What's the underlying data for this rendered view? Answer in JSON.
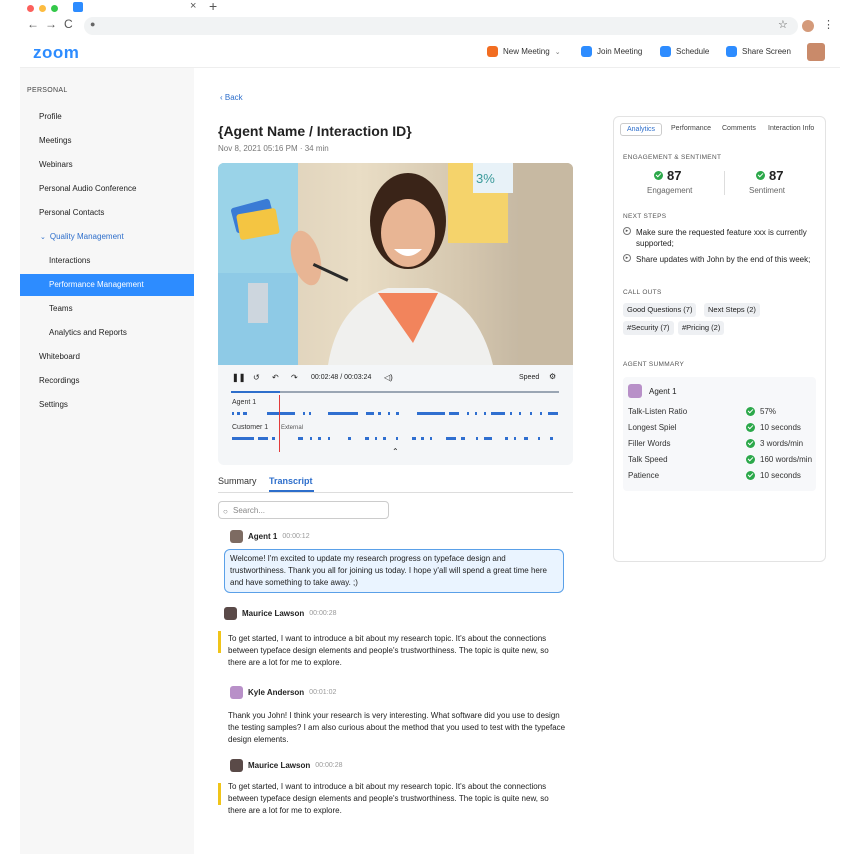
{
  "browser": {
    "back_arrow": "←",
    "forward_arrow": "→",
    "reload": "C",
    "tab_close": "×",
    "tab_new": "+"
  },
  "app": {
    "logo": "zoom",
    "toolbar": {
      "new_meeting": "New Meeting",
      "join_meeting": "Join Meeting",
      "schedule": "Schedule",
      "share_screen": "Share Screen"
    }
  },
  "sidebar": {
    "section": "PERSONAL",
    "items": [
      {
        "label": "Profile"
      },
      {
        "label": "Meetings"
      },
      {
        "label": "Webinars"
      },
      {
        "label": "Personal Audio Conference"
      },
      {
        "label": "Personal Contacts"
      },
      {
        "label": "Quality Management"
      },
      {
        "label": "Interactions"
      },
      {
        "label": "Performance Management"
      },
      {
        "label": "Teams"
      },
      {
        "label": "Analytics and Reports"
      },
      {
        "label": "Whiteboard"
      },
      {
        "label": "Recordings"
      },
      {
        "label": "Settings"
      }
    ]
  },
  "main": {
    "back": "Back",
    "title": "{Agent Name / Interaction ID}",
    "subtitle": "Nov 8, 2021 05:16 PM · 34 min",
    "player": {
      "time": "00:02:48 / 00:03:24",
      "speed": "Speed",
      "track_agent": "Agent 1",
      "track_customer": "Customer 1",
      "external": "External",
      "progress": 0.15
    },
    "tabs": {
      "summary": "Summary",
      "transcript": "Transcript"
    },
    "search_placeholder": "Search...",
    "transcript": [
      {
        "name": "Agent 1",
        "time": "00:00:12",
        "text": "Welcome! I'm excited to update my research progress on typeface design and trustworthiness. Thank you all for joining us today. I hope y'all will spend a great time here and have something to take away. ;)"
      },
      {
        "name": "Maurice Lawson",
        "time": "00:00:28",
        "text": "To get started, I want to introduce a bit about my research topic. It's about the connections between typeface design elements and people's trustworthiness. The topic is quite new, so there are a lot for me to explore."
      },
      {
        "name": "Kyle Anderson",
        "time": "00:01:02",
        "text": "Thank you John! I think your research is very interesting. What software did you use to design the testing samples? I am also curious about the method that you used to test with the typeface design elements."
      },
      {
        "name": "Maurice Lawson",
        "time": "00:00:28",
        "text": "To get started, I want to introduce a bit about my research topic. It's about the connections between typeface design elements and people's trustworthiness. The topic is quite new, so there are a lot for me to explore."
      }
    ]
  },
  "right_panel": {
    "tabs": [
      "Analytics",
      "Performance",
      "Comments",
      "Interaction Info"
    ],
    "engagement_title": "ENGAGEMENT & SENTIMENT",
    "engagement": {
      "value": "87",
      "label": "Engagement"
    },
    "sentiment": {
      "value": "87",
      "label": "Sentiment"
    },
    "next_steps_title": "NEXT STEPS",
    "next_steps": [
      "Make sure the requested feature xxx is currently supported;",
      "Share updates with John by the end of this week;"
    ],
    "callouts_title": "CALL OUTS",
    "callouts": [
      "Good Questions (7)",
      "Next Steps (2)",
      "#Security (7)",
      "#Pricing (2)"
    ],
    "agent_summary_title": "AGENT SUMMARY",
    "agent_name": "Agent 1",
    "metrics": [
      {
        "label": "Talk-Listen Ratio",
        "value": "57%"
      },
      {
        "label": "Longest Spiel",
        "value": "10 seconds"
      },
      {
        "label": "Filler Words",
        "value": "3 words/min"
      },
      {
        "label": "Talk Speed",
        "value": "160 words/min"
      },
      {
        "label": "Patience",
        "value": "10 seconds"
      }
    ]
  },
  "colors": {
    "accent": "#2d8cff",
    "link": "#2d6ecb",
    "success": "#2ca84a",
    "highlight": "#f0c419"
  }
}
